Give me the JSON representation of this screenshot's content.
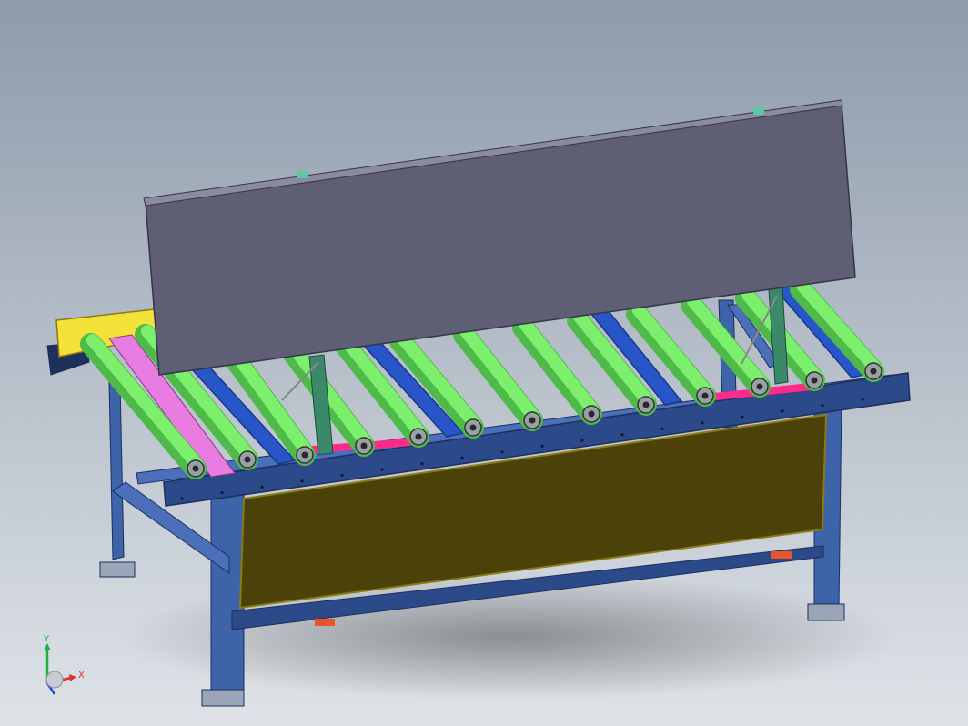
{
  "viewport": {
    "background_top": "#8e9bab",
    "background_bottom": "#dfe3e8"
  },
  "model": {
    "colors": {
      "frame": "#2c4a8a",
      "frame_light": "#4c6fbb",
      "frame_dark": "#1d2f5c",
      "leg": "#3d63a8",
      "roller": "#7cf06c",
      "roller_shade": "#4fb94a",
      "rail_blue": "#2856c8",
      "rail_blue_edge": "#163a8a",
      "panel": "#5e5e74",
      "panel_edge": "#34344a",
      "olive_panel": "#4a4208",
      "olive_edge": "#8a7a10",
      "yellow_block": "#f2e23a",
      "magenta_rail": "#e87ce0",
      "pink_bar": "#ff2a8a",
      "green_strut": "#3a8a6a",
      "bearing": "#9aa0a8",
      "foot_orange": "#e8552a"
    }
  },
  "triad": {
    "x_label": "X",
    "y_label": "Y",
    "x_color": "#e03030",
    "y_color": "#20b040",
    "z_color": "#2050e0"
  }
}
